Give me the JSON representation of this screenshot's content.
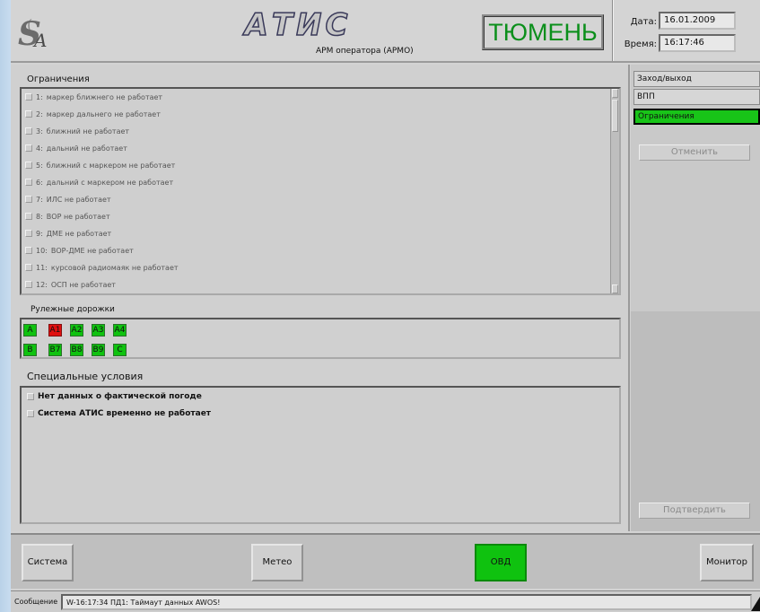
{
  "header": {
    "title": "АТИС",
    "subtitle": "АРМ оператора (АРМО)",
    "city": "ТЮМЕНЬ",
    "date_label": "Дата:",
    "date_value": "16.01.2009",
    "time_label": "Время:",
    "time_value": "16:17:46"
  },
  "restrictions": {
    "title": "Ограничения",
    "items": [
      {
        "num": "1:",
        "text": "маркер ближнего не работает"
      },
      {
        "num": "2:",
        "text": "маркер дальнего не работает"
      },
      {
        "num": "3:",
        "text": "ближний не работает"
      },
      {
        "num": "4:",
        "text": "дальний не работает"
      },
      {
        "num": "5:",
        "text": "ближний с маркером не работает"
      },
      {
        "num": "6:",
        "text": "дальний с маркером не работает"
      },
      {
        "num": "7:",
        "text": "ИЛС не работает"
      },
      {
        "num": "8:",
        "text": "ВОР не работает"
      },
      {
        "num": "9:",
        "text": "ДМЕ не работает"
      },
      {
        "num": "10:",
        "text": "ВОР-ДМЕ не работает"
      },
      {
        "num": "11:",
        "text": "курсовой радиомаяк не работает"
      },
      {
        "num": "12:",
        "text": "ОСП не работает"
      }
    ]
  },
  "taxiways": {
    "title": "Рулежные дорожки",
    "row1": [
      "A",
      "A1",
      "A2",
      "A3",
      "A4"
    ],
    "row2": [
      "B",
      "B7",
      "B8",
      "B9",
      "C"
    ],
    "colors": {
      "normal": "#0fc20f",
      "closed": "#e01010"
    }
  },
  "special": {
    "title": "Специальные условия",
    "items": [
      "Нет данных о фактической погоде",
      "Система АТИС временно не работает"
    ]
  },
  "side_menu": {
    "items": [
      "Заход/выход",
      "ВПП",
      "Ограничения"
    ],
    "cancel_label": "Отменить",
    "confirm_label": "Подтвердить"
  },
  "bottom": {
    "system_label": "Система",
    "meteo_label": "Метео",
    "ovd_label": "ОВД",
    "monitor_label": "Монитор"
  },
  "status": {
    "label": "Сообщение",
    "message": "W-16:17:34 ПД1: Таймаут данных AWOS!"
  },
  "icons": {
    "logo": "sa-logo-icon"
  }
}
